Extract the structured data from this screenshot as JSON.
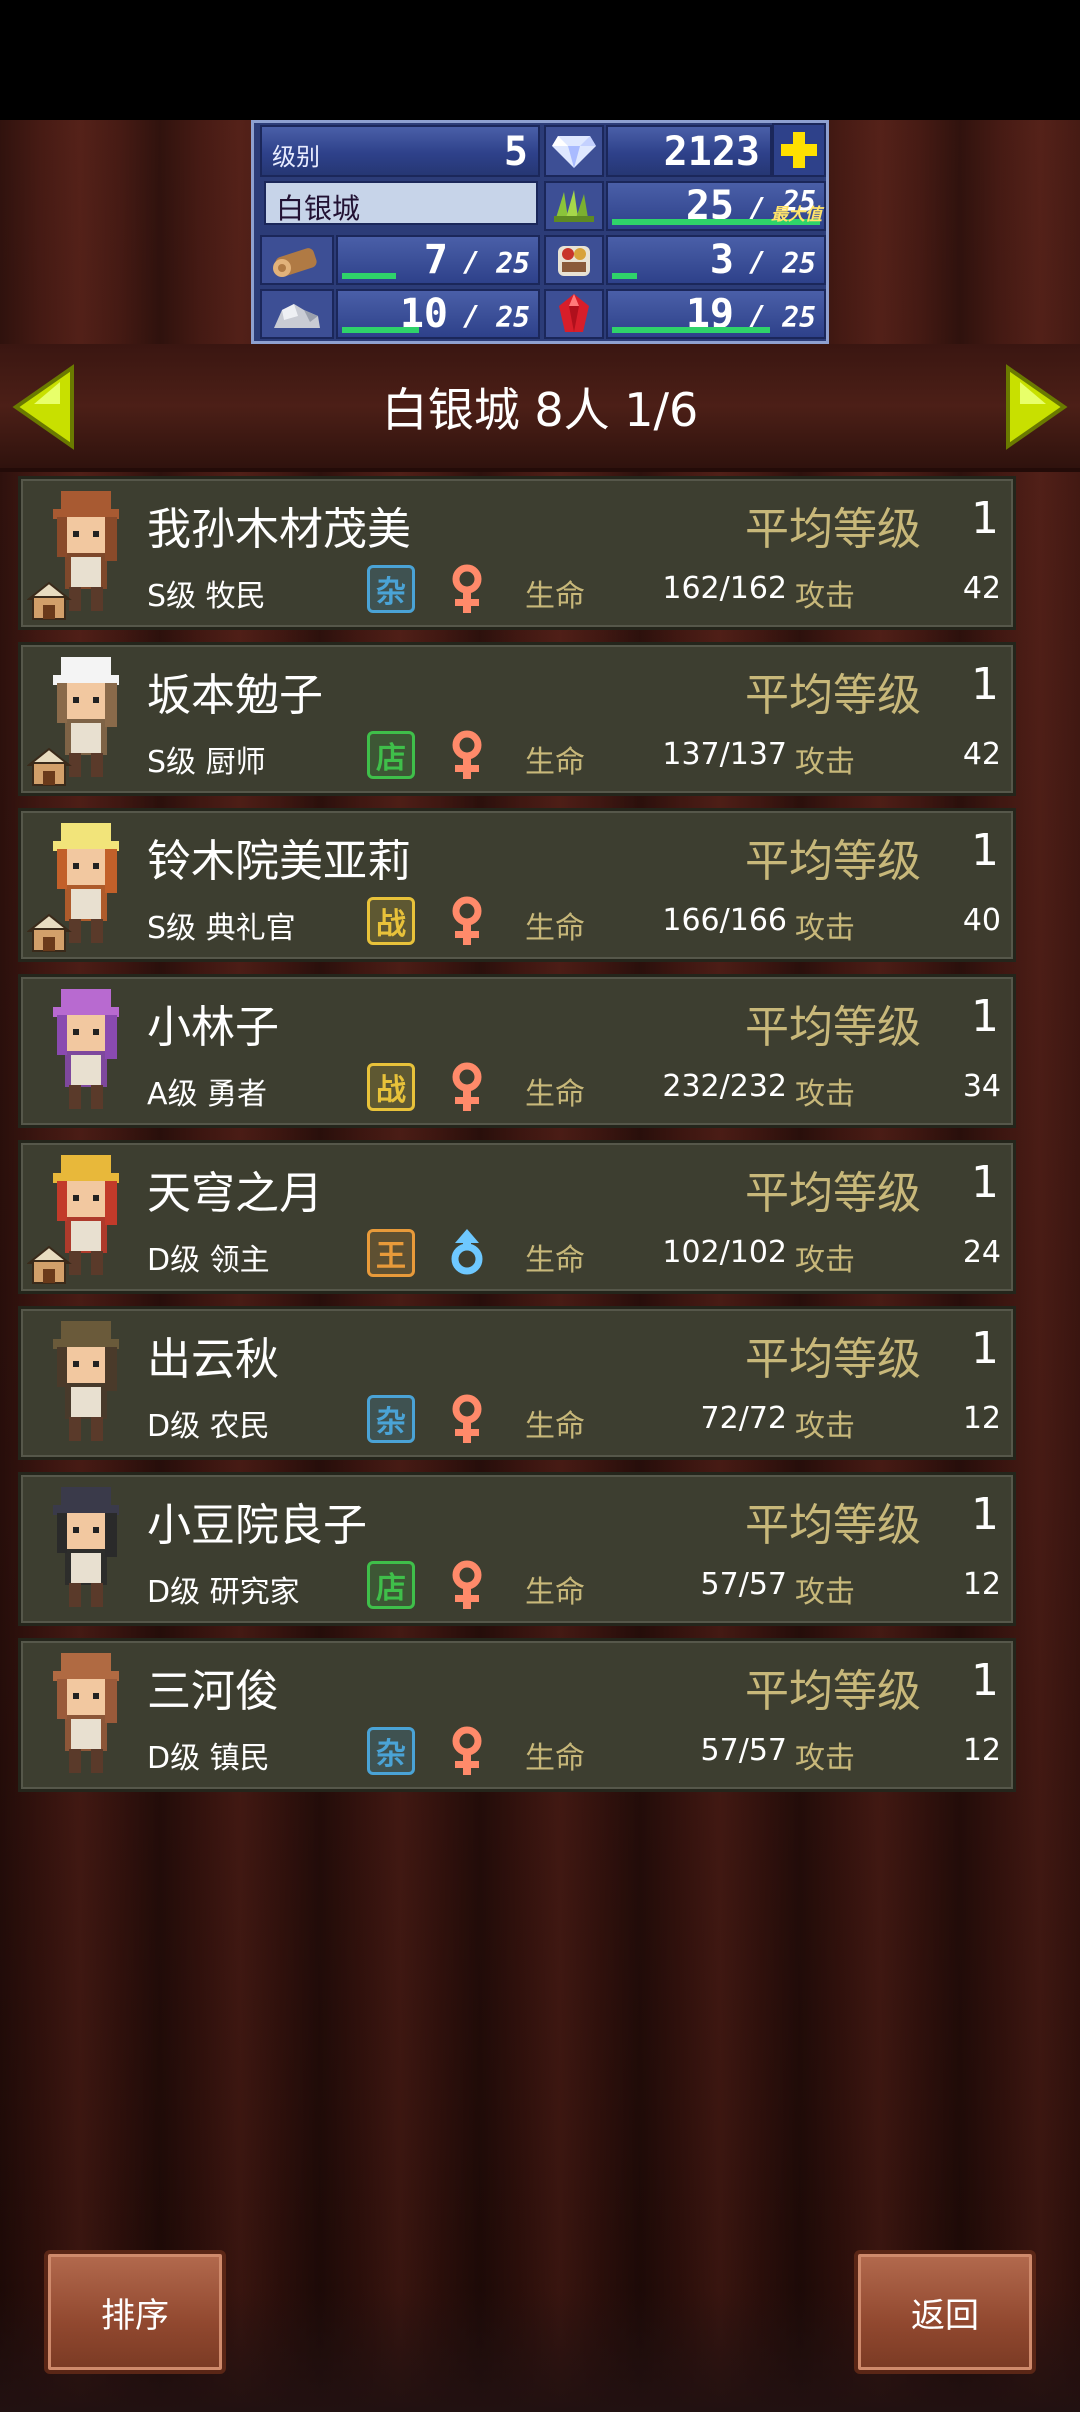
{
  "resources": {
    "level_label": "级别",
    "level_value": "5",
    "gems": "2123",
    "town_name": "白银城",
    "grass": {
      "current": "25",
      "max": "25",
      "max_label": "最大值",
      "fill": 1.0
    },
    "wood": {
      "current": "7",
      "max": "25",
      "fill": 0.28
    },
    "food": {
      "current": "3",
      "max": "25",
      "fill": 0.12
    },
    "ore": {
      "current": "10",
      "max": "25",
      "fill": 0.4
    },
    "mana": {
      "current": "19",
      "max": "25",
      "fill": 0.76
    },
    "slash": "/"
  },
  "header": {
    "title": "白银城  8人 1/6"
  },
  "labels": {
    "avg_level": "平均等级",
    "hp": "生命",
    "atk": "攻击"
  },
  "residents": [
    {
      "name": "我孙木材茂美",
      "rank": "S级 牧民",
      "type": "杂",
      "type_color": "#4aa3d6",
      "gender": "female",
      "avg": "1",
      "hp": "162/162",
      "atk": "42",
      "house": true,
      "hair": "#8a4a2a",
      "hat": "#a85a32"
    },
    {
      "name": "坂本勉子",
      "rank": "S级 厨师",
      "type": "店",
      "type_color": "#3fbf4a",
      "gender": "female",
      "avg": "1",
      "hp": "137/137",
      "atk": "42",
      "house": true,
      "hair": "#8a6a4a",
      "hat": "#f4f4f4"
    },
    {
      "name": "铃木院美亚莉",
      "rank": "S级 典礼官",
      "type": "战",
      "type_color": "#e8c23a",
      "gender": "female",
      "avg": "1",
      "hp": "166/166",
      "atk": "40",
      "house": true,
      "hair": "#c2602a",
      "hat": "#f2e47a"
    },
    {
      "name": "小林子",
      "rank": "A级 勇者",
      "type": "战",
      "type_color": "#e8c23a",
      "gender": "female",
      "avg": "1",
      "hp": "232/232",
      "atk": "34",
      "house": false,
      "hair": "#8a4ab0",
      "hat": "#b86ad0"
    },
    {
      "name": "天穹之月",
      "rank": "D级 领主",
      "type": "王",
      "type_color": "#e89a3a",
      "gender": "male",
      "avg": "1",
      "hp": "102/102",
      "atk": "24",
      "house": true,
      "hair": "#c23a2a",
      "hat": "#e8b83a"
    },
    {
      "name": "出云秋",
      "rank": "D级 农民",
      "type": "杂",
      "type_color": "#4aa3d6",
      "gender": "female",
      "avg": "1",
      "hp": "72/72",
      "atk": "12",
      "house": false,
      "hair": "#4a3a2a",
      "hat": "#6a5a3a"
    },
    {
      "name": "小豆院良子",
      "rank": "D级 研究家",
      "type": "店",
      "type_color": "#3fbf4a",
      "gender": "female",
      "avg": "1",
      "hp": "57/57",
      "atk": "12",
      "house": false,
      "hair": "#2a2a2a",
      "hat": "#3a3a4a"
    },
    {
      "name": "三河俊",
      "rank": "D级 镇民",
      "type": "杂",
      "type_color": "#4aa3d6",
      "gender": "female",
      "avg": "1",
      "hp": "57/57",
      "atk": "12",
      "house": false,
      "hair": "#9a5a3a",
      "hat": "#b06a42"
    }
  ],
  "buttons": {
    "sort": "排序",
    "back": "返回"
  }
}
